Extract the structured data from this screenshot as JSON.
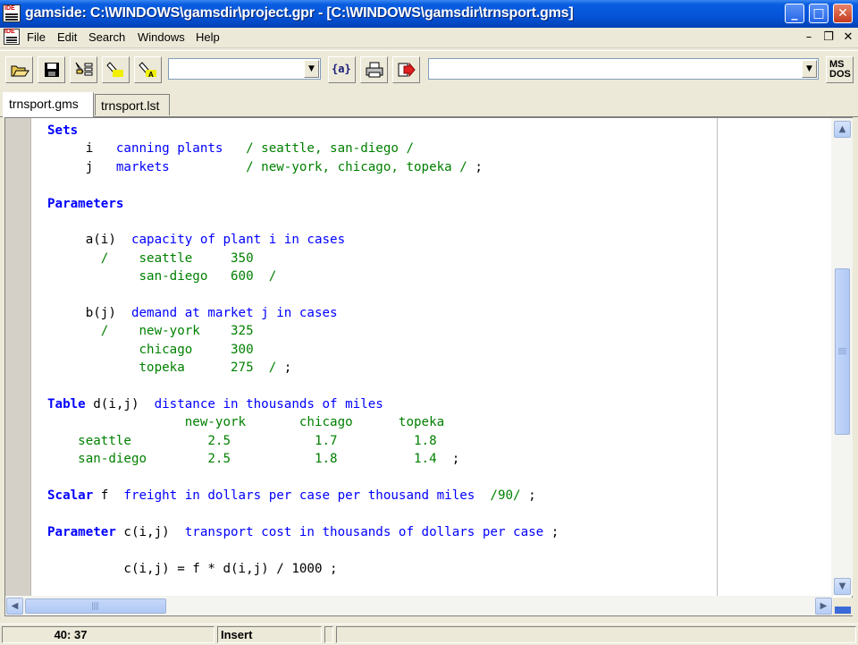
{
  "window": {
    "title": "gamside: C:\\WINDOWS\\gamsdir\\project.gpr - [C:\\WINDOWS\\gamsdir\\trnsport.gms]",
    "icon_label": "IDE",
    "minimize": "_",
    "maximize": "□",
    "close": "✕"
  },
  "menu": {
    "items": [
      "File",
      "Edit",
      "Search",
      "Windows",
      "Help"
    ],
    "mdi_minimize": "–",
    "mdi_restore": "❐",
    "mdi_close": "✕"
  },
  "toolbar": {
    "buttons": [
      "open-folder-icon",
      "save-disk-icon",
      "model-tree-icon",
      "highlighter-icon",
      "highlighter-a-icon",
      "brace-a-icon",
      "printer-icon",
      "run-arrow-icon",
      "model-library-icon"
    ],
    "brace_label": "{a}",
    "ms_label": "MS\nDOS",
    "combo1_value": "",
    "combo2_value": ""
  },
  "tabs": [
    {
      "label": "trnsport.gms",
      "active": true
    },
    {
      "label": "trnsport.lst",
      "active": false
    }
  ],
  "editor": {
    "lines": [
      [
        {
          "c": "kw",
          "t": "Sets"
        }
      ],
      [
        {
          "c": "bk",
          "t": "     i   "
        },
        {
          "c": "bl",
          "t": "canning plants   "
        },
        {
          "c": "gr",
          "t": "/ seattle, san-diego /"
        }
      ],
      [
        {
          "c": "bk",
          "t": "     j   "
        },
        {
          "c": "bl",
          "t": "markets          "
        },
        {
          "c": "gr",
          "t": "/ new-york, chicago, topeka / "
        },
        {
          "c": "bk",
          "t": ";"
        }
      ],
      [],
      [
        {
          "c": "kw",
          "t": "Parameters"
        }
      ],
      [],
      [
        {
          "c": "bk",
          "t": "     a(i)  "
        },
        {
          "c": "bl",
          "t": "capacity of plant i in cases"
        }
      ],
      [
        {
          "c": "gr",
          "t": "       /    seattle     350"
        }
      ],
      [
        {
          "c": "gr",
          "t": "            san-diego   600  /"
        }
      ],
      [],
      [
        {
          "c": "bk",
          "t": "     b(j)  "
        },
        {
          "c": "bl",
          "t": "demand at market j in cases"
        }
      ],
      [
        {
          "c": "gr",
          "t": "       /    new-york    325"
        }
      ],
      [
        {
          "c": "gr",
          "t": "            chicago     300"
        }
      ],
      [
        {
          "c": "gr",
          "t": "            topeka      275  /"
        },
        {
          "c": "bk",
          "t": " ;"
        }
      ],
      [],
      [
        {
          "c": "kw",
          "t": "Table "
        },
        {
          "c": "bk",
          "t": "d(i,j)  "
        },
        {
          "c": "bl",
          "t": "distance in thousands of miles"
        }
      ],
      [
        {
          "c": "gr",
          "t": "                  new-york       chicago      topeka"
        }
      ],
      [
        {
          "c": "gr",
          "t": "    seattle          2.5           1.7          1.8"
        }
      ],
      [
        {
          "c": "gr",
          "t": "    san-diego        2.5           1.8          1.4  "
        },
        {
          "c": "bk",
          "t": ";"
        }
      ],
      [],
      [
        {
          "c": "kw",
          "t": "Scalar "
        },
        {
          "c": "bk",
          "t": "f  "
        },
        {
          "c": "bl",
          "t": "freight in dollars per case per thousand miles  "
        },
        {
          "c": "gr",
          "t": "/90/"
        },
        {
          "c": "bk",
          "t": " ;"
        }
      ],
      [],
      [
        {
          "c": "kw",
          "t": "Parameter "
        },
        {
          "c": "bk",
          "t": "c(i,j)  "
        },
        {
          "c": "bl",
          "t": "transport cost in thousands of dollars per case "
        },
        {
          "c": "bk",
          "t": ";"
        }
      ],
      [],
      [
        {
          "c": "bk",
          "t": "          c(i,j) = f * d(i,j) / 1000 ;"
        }
      ]
    ]
  },
  "scrollbars": {
    "up": "▲",
    "down": "▼",
    "left": "◀",
    "right": "▶"
  },
  "status": {
    "position": "40: 37",
    "mode": "Insert",
    "pane3": "",
    "pane4": ""
  }
}
